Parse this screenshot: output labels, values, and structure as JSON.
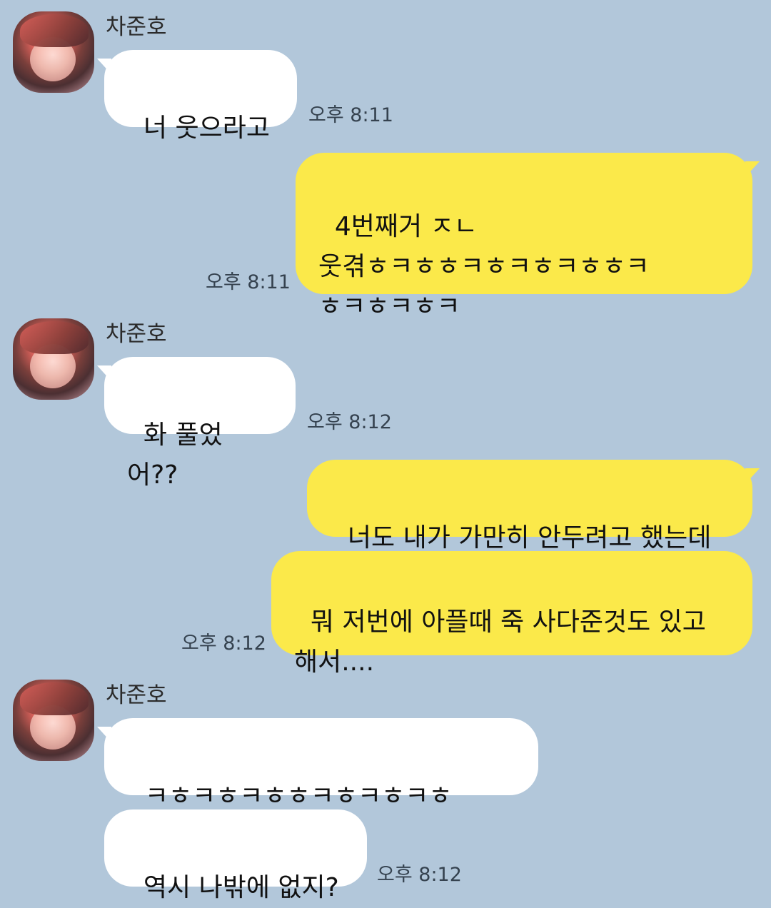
{
  "messages": [
    {
      "sender": "차준호",
      "text": "너 웃으라고",
      "time": "오후 8:11"
    },
    {
      "text": "4번째거 ㅈㄴ\n웃겪ㅎㅋㅎㅎㅋㅎㅋㅎㅋㅎㅎㅋ\nㅎㅋㅎㅋㅎㅋ",
      "time": "오후 8:11"
    },
    {
      "sender": "차준호",
      "text": "화 풀었어??",
      "time": "오후 8:12"
    },
    {
      "text": "너도 내가 가만히 안두려고 했는데"
    },
    {
      "text": "뭐 저번에 아플때 죽 사다준것도 있고\n해서....",
      "time": "오후 8:12"
    },
    {
      "sender": "차준호",
      "text": "ㅋㅎㅋㅎㅋㅎㅎㅋㅎㅋㅎㅋㅎ"
    },
    {
      "text": "역시 나밖에 없지?",
      "time": "오후 8:12"
    }
  ]
}
